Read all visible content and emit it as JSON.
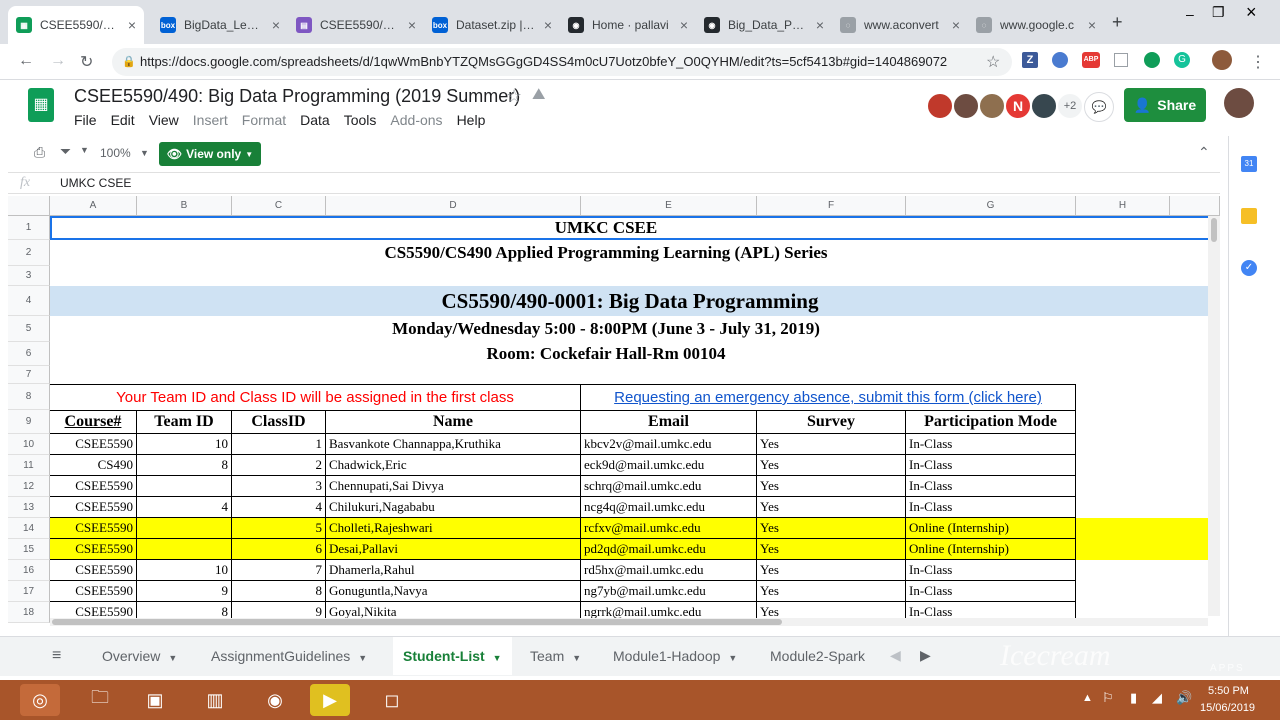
{
  "browser": {
    "tabs": [
      {
        "title": "CSEE5590/490: B",
        "fav_color": "#0f9d58",
        "fav_glyph": "▦",
        "active": true
      },
      {
        "title": "BigData_Lesso",
        "fav_color": "#0061d5",
        "fav_glyph": "box",
        "active": false
      },
      {
        "title": "CSEE5590/CS4",
        "fav_color": "#7e57c2",
        "fav_glyph": "▤",
        "active": false
      },
      {
        "title": "Dataset.zip | Po",
        "fav_color": "#0061d5",
        "fav_glyph": "box",
        "active": false
      },
      {
        "title": "Home · pallavi",
        "fav_color": "#24292e",
        "fav_glyph": "◉",
        "active": false
      },
      {
        "title": "Big_Data_Prog",
        "fav_color": "#24292e",
        "fav_glyph": "◉",
        "active": false
      },
      {
        "title": "www.aconvert",
        "fav_color": "#9aa0a6",
        "fav_glyph": "◌",
        "active": false
      },
      {
        "title": "www.google.c",
        "fav_color": "#9aa0a6",
        "fav_glyph": "◌",
        "active": false
      }
    ],
    "url": "https://docs.google.com/spreadsheets/d/1qwWmBnbYTZQMsGGgGD4SS4m0cU7Uotz0bfeY_O0QYHM/edit?ts=5cf5413b#gid=1404869072",
    "new_tab_glyph": "+"
  },
  "doc": {
    "title": "CSEE5590/490: Big Data Programming (2019 Summer)",
    "menu": [
      "File",
      "Edit",
      "View",
      "Insert",
      "Format",
      "Data",
      "Tools",
      "Add-ons",
      "Help"
    ],
    "collab_count": "+2",
    "collab_initial": "N",
    "share_label": "Share"
  },
  "toolbar": {
    "zoom": "100%",
    "view_only": "View only"
  },
  "formula": {
    "fx": "fx",
    "value": "UMKC CSEE"
  },
  "columns": [
    "A",
    "B",
    "C",
    "D",
    "E",
    "F",
    "G",
    "H"
  ],
  "row_numbers": [
    "1",
    "2",
    "3",
    "4",
    "5",
    "6",
    "7",
    "8",
    "9",
    "10",
    "11",
    "12",
    "13",
    "14",
    "15",
    "16",
    "17",
    "18"
  ],
  "sheet": {
    "r1": "UMKC CSEE",
    "r2": "CS5590/CS490 Applied Programming Learning (APL) Series",
    "r4": "CS5590/490-0001: Big Data Programming",
    "r5": "Monday/Wednesday 5:00 - 8:00PM  (June 3  - July 31, 2019)",
    "r6": "Room: Cockefair Hall-Rm 00104",
    "r8_left": "Your Team ID and Class ID will be assigned in the first class",
    "r8_right": "Requesting an emergency absence, submit this form (click here)",
    "headers": [
      "Course#",
      "Team ID",
      "ClassID",
      "Name",
      "Email",
      "Survey",
      "Participation Mode"
    ],
    "rows": [
      {
        "course": "CSEE5590",
        "team": "10",
        "cls": "1",
        "name": "Basvankote Channappa,Kruthika",
        "email": "kbcv2v@mail.umkc.edu",
        "survey": "Yes",
        "mode": "In-Class",
        "hl": false
      },
      {
        "course": "CS490",
        "team": "8",
        "cls": "2",
        "name": "Chadwick,Eric",
        "email": "eck9d@mail.umkc.edu",
        "survey": "Yes",
        "mode": "In-Class",
        "hl": false
      },
      {
        "course": "CSEE5590",
        "team": "",
        "cls": "3",
        "name": "Chennupati,Sai Divya",
        "email": "schrq@mail.umkc.edu",
        "survey": "Yes",
        "mode": "In-Class",
        "hl": false
      },
      {
        "course": "CSEE5590",
        "team": "4",
        "cls": "4",
        "name": "Chilukuri,Nagababu",
        "email": "ncg4q@mail.umkc.edu",
        "survey": "Yes",
        "mode": "In-Class",
        "hl": false
      },
      {
        "course": "CSEE5590",
        "team": "",
        "cls": "5",
        "name": "Cholleti,Rajeshwari",
        "email": "rcfxv@mail.umkc.edu",
        "survey": "Yes",
        "mode": "Online (Internship)",
        "hl": true
      },
      {
        "course": "CSEE5590",
        "team": "",
        "cls": "6",
        "name": "Desai,Pallavi",
        "email": "pd2qd@mail.umkc.edu",
        "survey": "Yes",
        "mode": "Online (Internship)",
        "hl": true
      },
      {
        "course": "CSEE5590",
        "team": "10",
        "cls": "7",
        "name": "Dhamerla,Rahul",
        "email": "rd5hx@mail.umkc.edu",
        "survey": "Yes",
        "mode": "In-Class",
        "hl": false
      },
      {
        "course": "CSEE5590",
        "team": "9",
        "cls": "8",
        "name": "Gonuguntla,Navya",
        "email": "ng7yb@mail.umkc.edu",
        "survey": "Yes",
        "mode": "In-Class",
        "hl": false
      },
      {
        "course": "CSEE5590",
        "team": "8",
        "cls": "9",
        "name": "Goyal,Nikita",
        "email": "ngrrk@mail.umkc.edu",
        "survey": "Yes",
        "mode": "In-Class",
        "hl": false
      }
    ]
  },
  "sheet_tabs": [
    "Overview",
    "AssignmentGuidelines",
    "Student-List",
    "Team",
    "Module1-Hadoop",
    "Module2-Spark"
  ],
  "active_sheet": "Student-List",
  "taskbar": {
    "time": "5:50 PM",
    "date": "15/06/2019",
    "watermark": "Icecream",
    "watermark_sub": "APPS"
  },
  "colors": {
    "accent_green": "#188038",
    "share_green": "#1e8e3e",
    "highlight_yellow": "#ffff00",
    "title_band": "#cfe2f3",
    "red_text": "#ff0000",
    "link_blue": "#1155cc",
    "taskbar": "#a8552a"
  }
}
